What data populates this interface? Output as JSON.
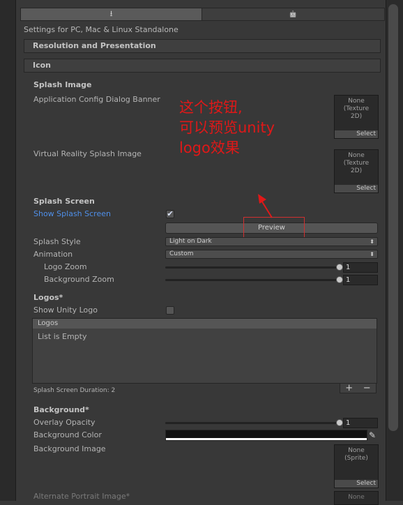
{
  "platform_tabs": [
    {
      "icon": "download-icon",
      "label": "⭳"
    },
    {
      "icon": "android-icon",
      "label": "🤖"
    }
  ],
  "settings_for": "Settings for PC, Mac & Linux Standalone",
  "sections": {
    "resolution": "Resolution and Presentation",
    "icon": "Icon",
    "splash_image": "Splash Image"
  },
  "splash_image": {
    "app_config_banner_label": "Application Config Dialog Banner",
    "vr_splash_label": "Virtual Reality Splash Image",
    "texture_none": "None",
    "texture_type": "(Texture 2D)",
    "select_label": "Select"
  },
  "splash_screen": {
    "header": "Splash Screen",
    "show_label": "Show Splash Screen",
    "show_checked": "✔",
    "preview_label": "Preview",
    "style_label": "Splash Style",
    "style_value": "Light on Dark",
    "animation_label": "Animation",
    "animation_value": "Custom",
    "logo_zoom_label": "Logo Zoom",
    "logo_zoom_value": "1",
    "logo_zoom_level": 1.0,
    "bg_zoom_label": "Background Zoom",
    "bg_zoom_value": "1",
    "bg_zoom_level": 1.0,
    "dropdown_arrow": "⬍"
  },
  "logos": {
    "header": "Logos*",
    "show_unity_label": "Show Unity Logo",
    "list_header": "Logos",
    "list_empty": "List is Empty",
    "duration_label": "Splash Screen Duration: 2",
    "add": "+",
    "remove": "−"
  },
  "background": {
    "header": "Background*",
    "overlay_label": "Overlay Opacity",
    "overlay_value": "1",
    "overlay_level": 1.0,
    "color_label": "Background Color",
    "color": "#111111",
    "image_label": "Background Image",
    "sprite_none": "None",
    "sprite_type": "(Sprite)",
    "select_label": "Select",
    "alt_portrait_label": "Alternate Portrait Image*",
    "alt_none": "None"
  },
  "annotation": {
    "line1": "这个按钮,",
    "line2": "可以预览unity",
    "line3": "logo效果",
    "color": "#e01818"
  }
}
